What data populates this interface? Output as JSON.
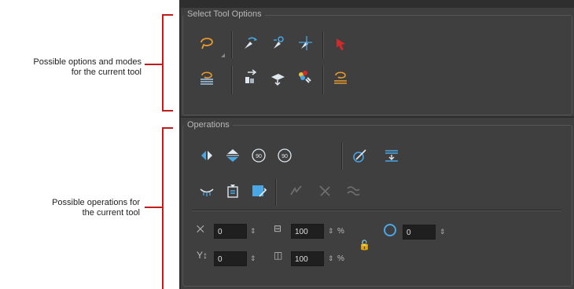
{
  "callouts": {
    "options": "Possible options and modes\nfor the current tool",
    "operations": "Possible operations for\nthe current tool"
  },
  "select_tool_options": {
    "title": "Select Tool Options",
    "row1": [
      "lasso-icon",
      "select-transform-icon",
      "select-rotate-icon",
      "select-scale-icon",
      "select-skew-icon"
    ],
    "row2": [
      "lasso-layers-icon",
      "select-by-color-icon",
      "select-flip-icon",
      "color-link-icon",
      "lasso-lines-icon"
    ]
  },
  "operations": {
    "title": "Operations",
    "row1": [
      "flip-horizontal-icon",
      "flip-vertical-icon",
      "rotate-90-cw-icon",
      "rotate-90-ccw-icon",
      "pick-color-icon",
      "flatten-icon"
    ],
    "row2": [
      "create-empty-drawing-icon",
      "store-drawing-icon",
      "fill-selection-icon",
      "merge-lines-icon",
      "cut-lines-icon",
      "smooth-lines-icon"
    ],
    "fields": {
      "x": {
        "value": "0"
      },
      "y": {
        "value": "0"
      },
      "width": {
        "value": "100",
        "unit": "%"
      },
      "height": {
        "value": "100",
        "unit": "%"
      },
      "angle": {
        "value": "0"
      }
    }
  },
  "colors": {
    "accent_orange": "#e89a2c",
    "accent_blue": "#4aa7e6",
    "red": "#d12a2a",
    "callout_red": "#c01d1d"
  }
}
